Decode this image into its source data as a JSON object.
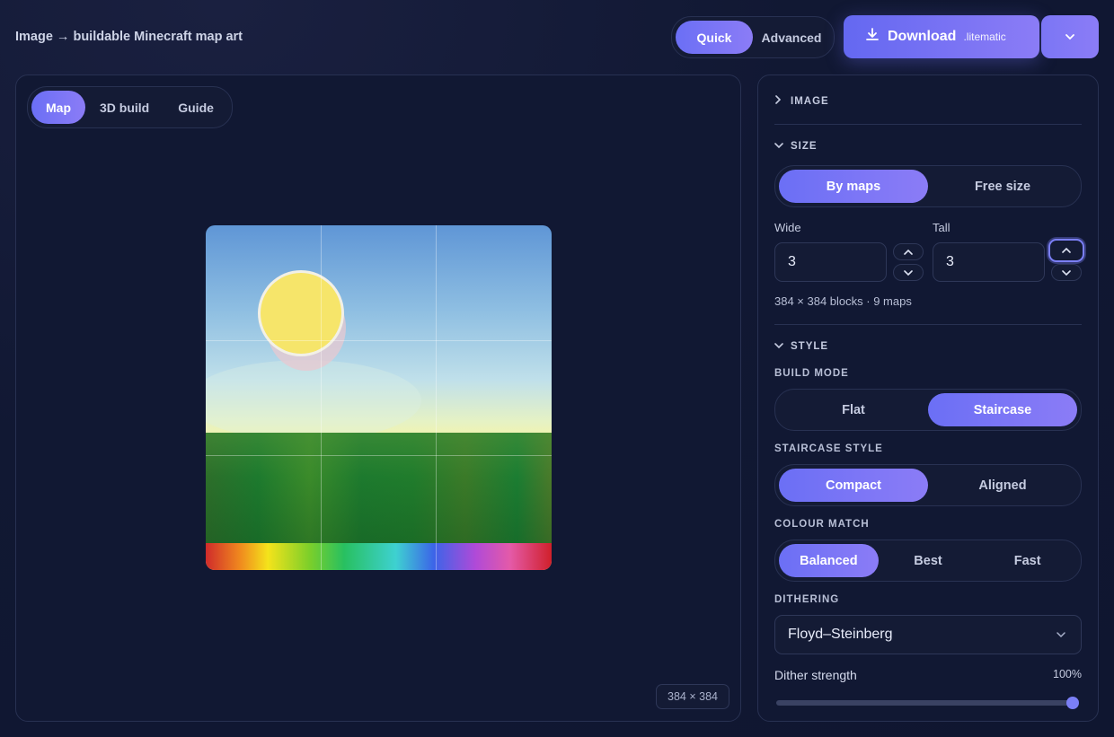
{
  "header": {
    "title": "Image → buildable Minecraft map art",
    "mode_options": [
      "Quick",
      "Advanced"
    ],
    "mode_selected": "Quick",
    "download_label": "Download",
    "download_ext": ".litematic"
  },
  "preview": {
    "tabs": [
      "Map",
      "3D build",
      "Guide"
    ],
    "tab_selected": "Map",
    "dimensions": "384 × 384"
  },
  "sidebar": {
    "image_section": "IMAGE",
    "size_section": "SIZE",
    "size_modes": [
      "By maps",
      "Free size"
    ],
    "size_mode_selected": "By maps",
    "wide_label": "Wide",
    "wide_value": "3",
    "tall_label": "Tall",
    "tall_value": "3",
    "size_summary": "384 × 384 blocks · 9 maps",
    "style_section": "STYLE",
    "build_mode_label": "BUILD MODE",
    "build_modes": [
      "Flat",
      "Staircase"
    ],
    "build_mode_selected": "Staircase",
    "staircase_style_label": "STAIRCASE STYLE",
    "staircase_styles": [
      "Compact",
      "Aligned"
    ],
    "staircase_style_selected": "Compact",
    "colour_match_label": "COLOUR MATCH",
    "colour_matches": [
      "Balanced",
      "Best",
      "Fast"
    ],
    "colour_match_selected": "Balanced",
    "dithering_label": "DITHERING",
    "dithering_value": "Floyd–Steinberg",
    "dither_strength_label": "Dither strength",
    "dither_strength_value": "100%",
    "dither_strength_fraction": 1.0
  },
  "colors": {
    "accent": "#6b6ff5",
    "accent2": "#8b7cf6",
    "background": "#111833"
  }
}
